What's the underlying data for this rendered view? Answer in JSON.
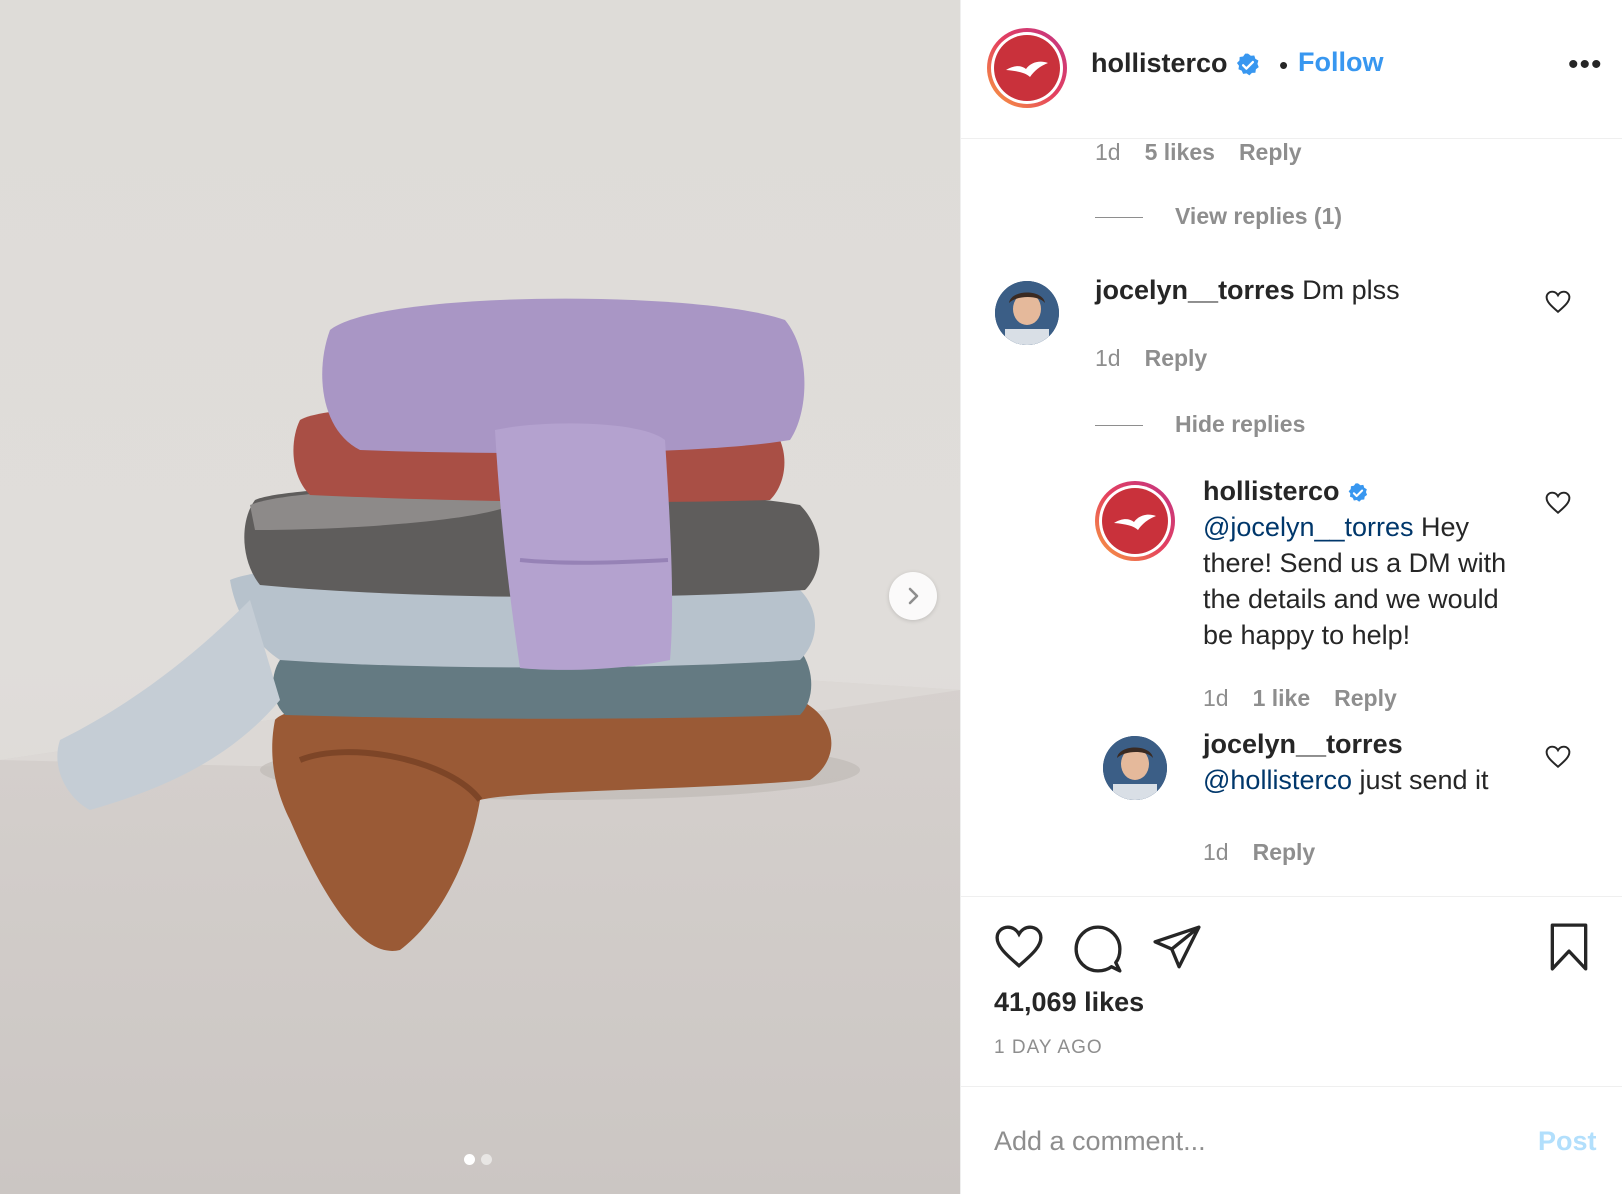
{
  "post": {
    "username": "hollisterco",
    "follow_label": "Follow",
    "separator": "•",
    "more_label": "•••",
    "likes_text": "41,069 likes",
    "time_ago": "1 DAY AGO",
    "carousel": {
      "total": 2,
      "current": 1
    }
  },
  "comments": {
    "top_meta": {
      "time": "1d",
      "likes": "5 likes",
      "reply": "Reply"
    },
    "view_replies": "View replies (1)",
    "c1": {
      "username": "jocelyn__torres",
      "text": "Dm plss",
      "time": "1d",
      "reply": "Reply"
    },
    "hide_replies": "Hide replies",
    "r1": {
      "username": "hollisterco",
      "mention": "@jocelyn__torres",
      "text_line1_rest": " Hey",
      "text_line2": "there! Send us a DM with",
      "text_line3": "the details and we would",
      "text_line4": "be happy to help!",
      "time": "1d",
      "likes": "1 like",
      "reply": "Reply"
    },
    "r2": {
      "username": "jocelyn__torres",
      "mention": "@hollisterco",
      "text_rest": " just send it",
      "time": "1d",
      "reply": "Reply"
    }
  },
  "composer": {
    "placeholder": "Add a comment...",
    "post_label": "Post"
  },
  "icons": {
    "like": "heart-icon",
    "comment": "comment-icon",
    "share": "paper-plane-icon",
    "save": "bookmark-icon",
    "next": "chevron-right-icon",
    "verified": "verified-badge-icon"
  },
  "colors": {
    "accent": "#3897f0",
    "brand": "#c9313b",
    "post_disabled": "#b2dffc",
    "muted": "#8e8e8e"
  }
}
